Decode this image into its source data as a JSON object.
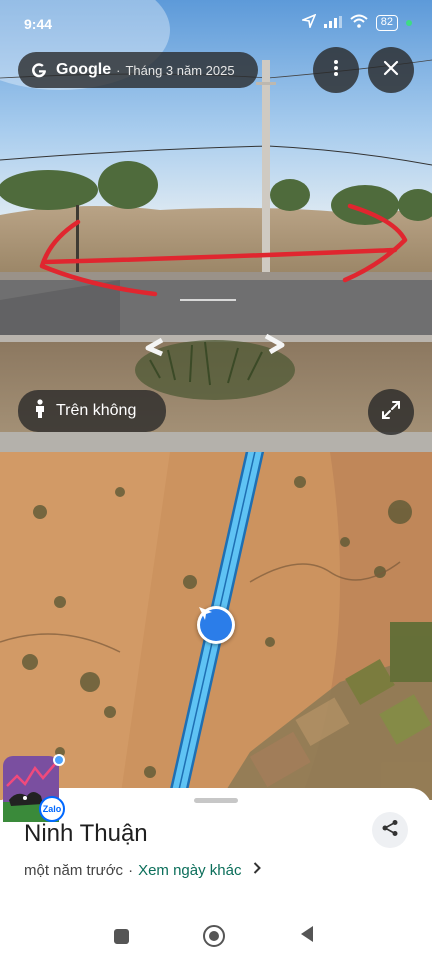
{
  "status": {
    "time": "9:44",
    "battery": "82"
  },
  "title_bar": {
    "brand": "Google",
    "separator": "·",
    "date": "Tháng 3 năm 2025"
  },
  "aerial": {
    "label": "Trên không"
  },
  "place": {
    "name": "Ninh Thuận",
    "captured": "một năm trước",
    "separator": "·",
    "other_dates_link": "Xem ngày khác"
  },
  "zalo": {
    "label": "Zalo"
  },
  "icons": {
    "google": "google-g-icon",
    "menu": "more-vert-icon",
    "close": "close-icon",
    "person": "person-icon",
    "expand": "expand-icon",
    "share": "share-icon",
    "location": "navigation-arrow-icon",
    "chevron": "chevron-right-icon"
  },
  "colors": {
    "link": "#0b6e5a",
    "route": "#4fb7f0",
    "annotation": "#e0262f",
    "location": "#2b7de9"
  }
}
